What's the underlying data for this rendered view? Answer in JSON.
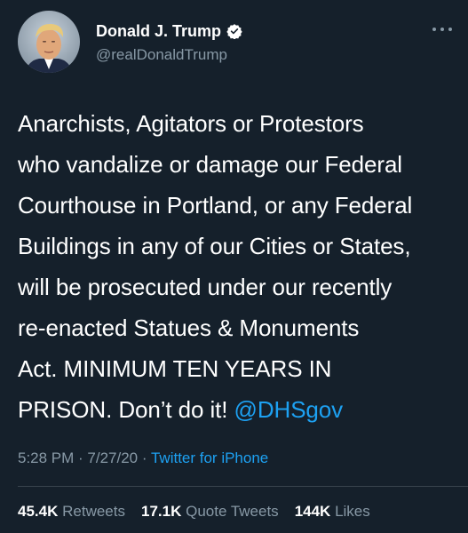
{
  "author": {
    "display_name": "Donald J. Trump",
    "handle": "@realDonaldTrump",
    "verified": true
  },
  "tweet": {
    "lines": [
      "Anarchists, Agitators or Protestors",
      "who vandalize or damage our Federal",
      "Courthouse in Portland, or any Federal",
      "Buildings in any of our Cities or States,",
      "will be prosecuted under our recently",
      "re-enacted Statues & Monuments",
      "Act. MINIMUM TEN YEARS IN"
    ],
    "last_line_text": "PRISON. Don’t do it! ",
    "mention": "@DHSgov"
  },
  "meta": {
    "time": "5:28 PM",
    "separator": " · ",
    "date": "7/27/20",
    "source": "Twitter for iPhone"
  },
  "stats": {
    "retweets_count": "45.4K",
    "retweets_label": "Retweets",
    "quotes_count": "17.1K",
    "quotes_label": "Quote Tweets",
    "likes_count": "144K",
    "likes_label": "Likes"
  },
  "colors": {
    "background": "#15202b",
    "text": "#ffffff",
    "secondary": "#8899a6",
    "accent": "#1da1f2",
    "divider": "#38444d"
  },
  "icons": {
    "verified": "verified-badge-icon",
    "more": "more-options-icon"
  }
}
